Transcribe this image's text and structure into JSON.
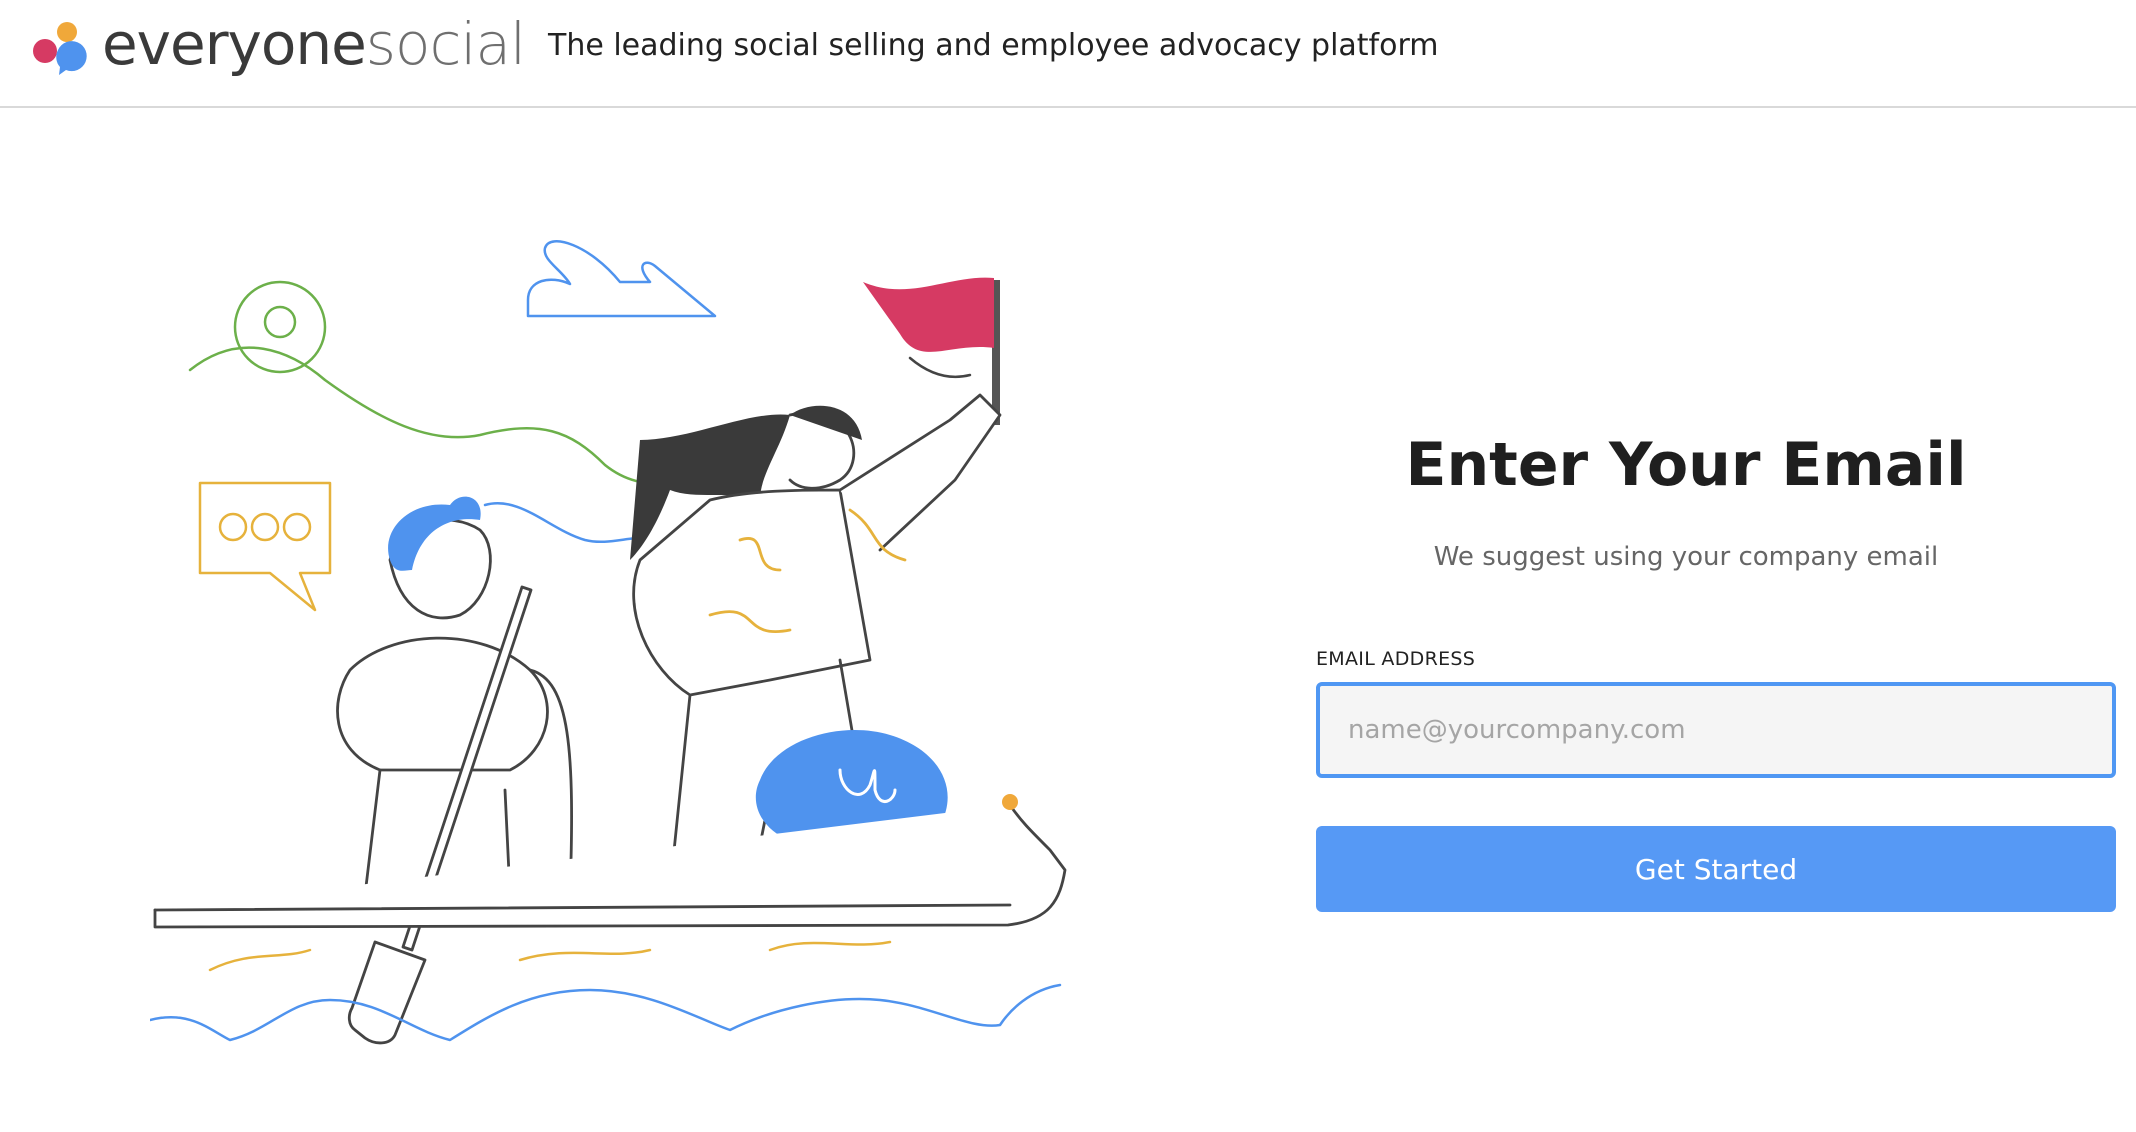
{
  "header": {
    "logo_word_1": "everyone",
    "logo_word_2": "social",
    "tagline": "The leading social selling and employee advocacy platform"
  },
  "colors": {
    "brand_red": "#d63a63",
    "brand_orange": "#f0a83a",
    "brand_blue": "#4f93ee",
    "button_blue": "#5699f5",
    "input_border": "#4f97f3"
  },
  "form": {
    "title": "Enter Your Email",
    "subtitle": "We suggest using your company email",
    "email_label": "EMAIL ADDRESS",
    "email_value": "",
    "email_placeholder": "name@yourcompany.com",
    "submit_label": "Get Started"
  }
}
